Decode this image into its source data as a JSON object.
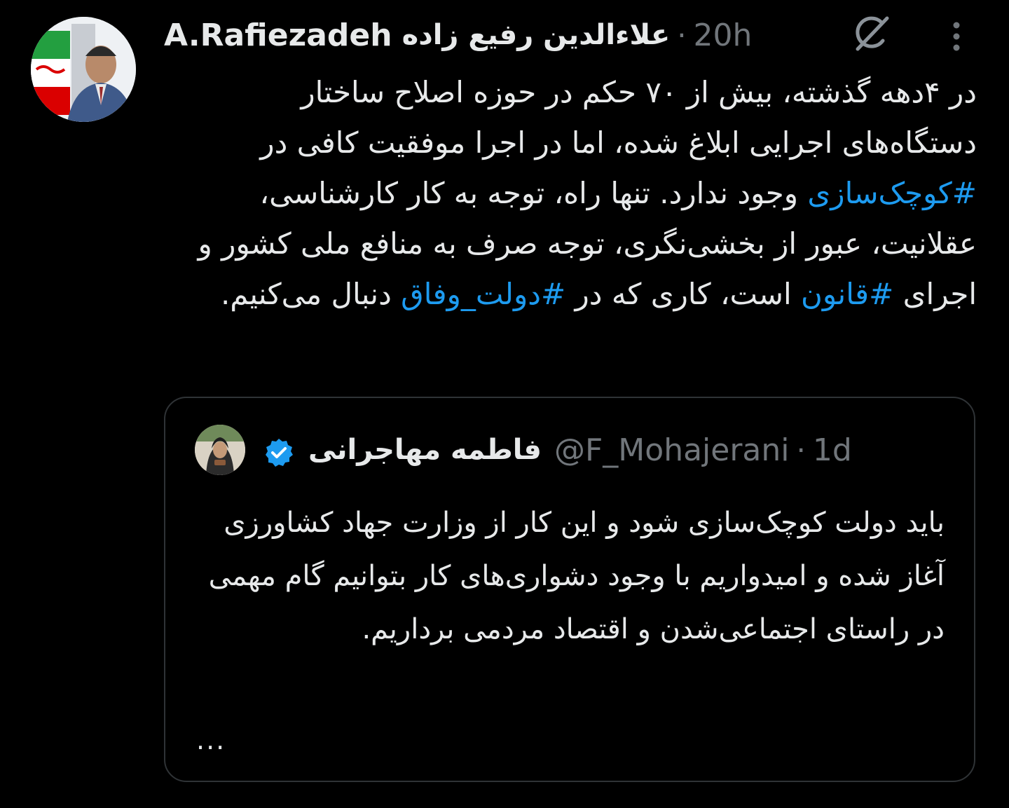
{
  "author": {
    "display_name": "A.Rafiezadeh",
    "display_name_fa": "علاءالدین رفیع زاده",
    "separator": "·",
    "time": "20h"
  },
  "icons": {
    "grok": "grok-icon",
    "more": "more-options-icon",
    "verified": "verified-badge-icon"
  },
  "tweet": {
    "segments": [
      {
        "text": "در ۴دهه گذشته، بیش از ۷۰ حکم در حوزه اصلاح ساختار دستگاه‌های اجرایی ابلاغ شده، اما در اجرا موفقیت کافی در ",
        "hashtag": false
      },
      {
        "text": "#کوچک‌سازی",
        "hashtag": true
      },
      {
        "text": " وجود ندارد. تنها راه، توجه به کار کارشناسی، عقلانیت، عبور از بخشی‌نگری، توجه صرف به منافع ملی کشور و اجرای ",
        "hashtag": false
      },
      {
        "text": "#قانون",
        "hashtag": true
      },
      {
        "text": " است، کاری که در ",
        "hashtag": false
      },
      {
        "text": "#دولت_وفاق",
        "hashtag": true
      },
      {
        "text": " دنبال می‌کنیم.",
        "hashtag": false
      }
    ]
  },
  "quoted_tweet": {
    "name": "فاطمه مهاجرانی",
    "handle": "@F_Mohajerani",
    "separator": "·",
    "time": "1d",
    "text": "باید دولت کوچک‌سازی شود و این کار از وزارت جهاد کشاورزی آغاز شده و امیدواریم با وجود دشواری‌های کار بتوانیم گام مهمی در راستای اجتماعی‌شدن و اقتصاد مردمی برداریم.",
    "ellipsis": "..."
  },
  "colors": {
    "background": "#000000",
    "text": "#e7e9ea",
    "muted": "#71767b",
    "link": "#1d9bf0",
    "border": "#2f3336"
  }
}
